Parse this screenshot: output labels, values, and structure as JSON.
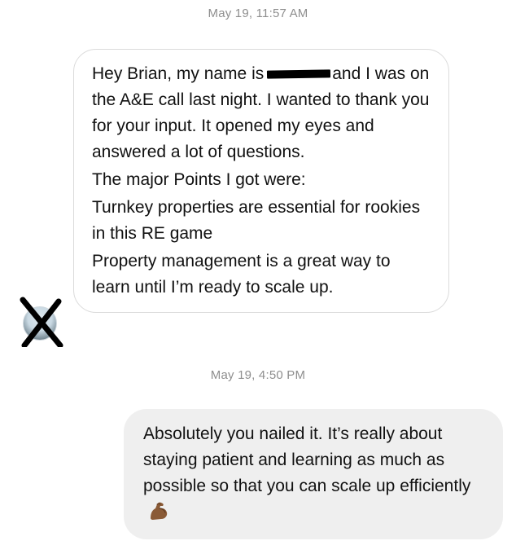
{
  "thread": {
    "timestamp_1": "May 19, 11:57 AM",
    "timestamp_2": "May 19, 4:50 PM"
  },
  "incoming_message": {
    "line_1_start": "Hey Brian, my name is",
    "line_1_end": "and I was on the A&E call last night. I wanted to thank you for your input. It opened my eyes and answered a lot of questions.",
    "paragraph_2": "The major Points I got were:",
    "paragraph_3": "Turnkey properties are essential for rookies in this RE game",
    "paragraph_4": "Property management is a great way to learn until I’m ready to scale up."
  },
  "outgoing_message": {
    "text": "Absolutely you nailed it.  It’s really about staying patient and learning as much as possible so that you can scale up efficiently",
    "emoji": "flexed-biceps-icon"
  },
  "colors": {
    "timestamp": "#8e8e8e",
    "incoming_border": "#dbdbdb",
    "outgoing_background": "#efefef",
    "redaction": "#000000"
  }
}
